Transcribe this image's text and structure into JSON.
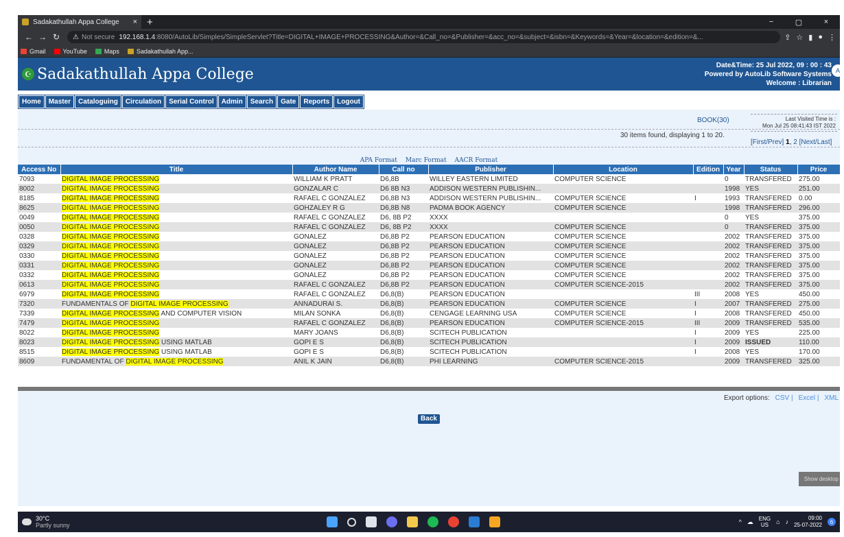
{
  "browser": {
    "tab_title": "Sadakathullah Appa College",
    "tab_close": "×",
    "new_tab": "+",
    "win_min": "−",
    "win_max": "▢",
    "win_close": "×",
    "not_secure": "Not secure",
    "url_host": "192.168.1.4",
    "url_path": ":8080/AutoLib/Simples/SimpleServlet?Title=DIGITAL+IMAGE+PROCESSING&Author=&Call_no=&Publisher=&acc_no=&subject=&isbn=&Keywords=&Year=&location=&edition=&...",
    "bookmarks": [
      {
        "label": "Gmail",
        "color": "#ea4335"
      },
      {
        "label": "YouTube",
        "color": "#ff0000"
      },
      {
        "label": "Maps",
        "color": "#34a853"
      },
      {
        "label": "Sadakathullah App...",
        "color": "#c9a227"
      }
    ]
  },
  "header": {
    "site_title": "Sadakathullah Appa College",
    "datetime": "Date&Time:  25 Jul 2022, 09 : 00 : 43",
    "powered_by": "Powered by AutoLib Software Systems",
    "welcome": "Welcome  :  Librarian"
  },
  "menu": [
    "Home",
    "Master",
    "Cataloguing",
    "Circulation",
    "Serial Control",
    "Admin",
    "Search",
    "Gate",
    "Reports",
    "Logout"
  ],
  "info": {
    "book_count": "BOOK(30)",
    "last_visited_label": "Last Visited Time is :",
    "last_visited_value": "Mon Jul 25 08:41:43 IST 2022",
    "found_text": "30 items found, displaying 1 to 20.",
    "pager_first_prev": "[First/Prev]",
    "pager_page1": "1",
    "pager_page2": "2",
    "pager_next_last": "[Next/Last]"
  },
  "formats": [
    "APA Format",
    "Marc Format",
    "AACR Format"
  ],
  "columns": [
    "Access No",
    "Title",
    "Author Name",
    "Call no",
    "Publisher",
    "Location",
    "Edition",
    "Year",
    "Status",
    "Price"
  ],
  "rows": [
    {
      "acc": "7093",
      "pre": "",
      "hl": "DIGITAL IMAGE PROCESSING",
      "post": "",
      "author": "WILLIAM K PRATT",
      "call": "D6,8B",
      "publisher": "WILLEY EASTERN LIMITED",
      "location": "COMPUTER SCIENCE",
      "edition": "",
      "year": "0",
      "status": "TRANSFERED",
      "price": "275.00"
    },
    {
      "acc": "8002",
      "pre": "",
      "hl": "DIGITAL IMAGE PROCESSING",
      "post": "",
      "author": "GONZALAR C",
      "call": "D6 8B N3",
      "publisher": "ADDISON WESTERN PUBLISHIN...",
      "location": "",
      "edition": "",
      "year": "1998",
      "status": "YES",
      "price": "251.00"
    },
    {
      "acc": "8185",
      "pre": "",
      "hl": "DIGITAL IMAGE PROCESSING",
      "post": "",
      "author": "RAFAEL C GONZALEZ",
      "call": "D6,8B N3",
      "publisher": "ADDISON WESTERN PUBLISHIN...",
      "location": "COMPUTER SCIENCE",
      "edition": "I",
      "year": "1993",
      "status": "TRANSFERED",
      "price": "0.00"
    },
    {
      "acc": "8625",
      "pre": "",
      "hl": "DIGITAL IMAGE PROCESSING",
      "post": "",
      "author": "GOHZALEY R G",
      "call": "D6,8B N8",
      "publisher": "PADMA BOOK AGENCY",
      "location": "COMPUTER SCIENCE",
      "edition": "",
      "year": "1998",
      "status": "TRANSFERED",
      "price": "296.00"
    },
    {
      "acc": "0049",
      "pre": "",
      "hl": "DIGITAL IMAGE PROCESSING",
      "post": "",
      "author": "RAFAEL C GONZALEZ",
      "call": "D6, 8B P2",
      "publisher": "XXXX",
      "location": "",
      "edition": "",
      "year": "0",
      "status": "YES",
      "price": "375.00"
    },
    {
      "acc": "0050",
      "pre": "",
      "hl": "DIGITAL IMAGE PROCESSING",
      "post": "",
      "author": "RAFAEL C GONZALEZ",
      "call": "D6, 8B P2",
      "publisher": "XXXX",
      "location": "COMPUTER SCIENCE",
      "edition": "",
      "year": "0",
      "status": "TRANSFERED",
      "price": "375.00"
    },
    {
      "acc": "0328",
      "pre": "",
      "hl": "DIGITAL IMAGE PROCESSING",
      "post": "",
      "author": "GONALEZ",
      "call": "D6,8B P2",
      "publisher": "PEARSON EDUCATION",
      "location": "COMPUTER SCIENCE",
      "edition": "",
      "year": "2002",
      "status": "TRANSFERED",
      "price": "375.00"
    },
    {
      "acc": "0329",
      "pre": "",
      "hl": "DIGITAL IMAGE PROCESSING",
      "post": "",
      "author": "GONALEZ",
      "call": "D6,8B P2",
      "publisher": "PEARSON EDUCATION",
      "location": "COMPUTER SCIENCE",
      "edition": "",
      "year": "2002",
      "status": "TRANSFERED",
      "price": "375.00"
    },
    {
      "acc": "0330",
      "pre": "",
      "hl": "DIGITAL IMAGE PROCESSING",
      "post": "",
      "author": "GONALEZ",
      "call": "D6,8B P2",
      "publisher": "PEARSON EDUCATION",
      "location": "COMPUTER SCIENCE",
      "edition": "",
      "year": "2002",
      "status": "TRANSFERED",
      "price": "375.00"
    },
    {
      "acc": "0331",
      "pre": "",
      "hl": "DIGITAL IMAGE PROCESSING",
      "post": "",
      "author": "GONALEZ",
      "call": "D6,8B P2",
      "publisher": "PEARSON EDUCATION",
      "location": "COMPUTER SCIENCE",
      "edition": "",
      "year": "2002",
      "status": "TRANSFERED",
      "price": "375.00"
    },
    {
      "acc": "0332",
      "pre": "",
      "hl": "DIGITAL IMAGE PROCESSING",
      "post": "",
      "author": "GONALEZ",
      "call": "D6,8B P2",
      "publisher": "PEARSON EDUCATION",
      "location": "COMPUTER SCIENCE",
      "edition": "",
      "year": "2002",
      "status": "TRANSFERED",
      "price": "375.00"
    },
    {
      "acc": "0613",
      "pre": "",
      "hl": "DIGITAL IMAGE PROCESSING",
      "post": "",
      "author": "RAFAEL C GONZALEZ",
      "call": "D6,8B P2",
      "publisher": "PEARSON EDUCATION",
      "location": "COMPUTER SCIENCE-2015",
      "edition": "",
      "year": "2002",
      "status": "TRANSFERED",
      "price": "375.00"
    },
    {
      "acc": "6979",
      "pre": "",
      "hl": "DIGITAL IMAGE PROCESSING",
      "post": "",
      "author": "RAFAEL C GONZALEZ",
      "call": "D6,8(B)",
      "publisher": "PEARSON EDUCATION",
      "location": "",
      "edition": "III",
      "year": "2008",
      "status": "YES",
      "price": "450.00"
    },
    {
      "acc": "7320",
      "pre": "FUNDAMENTALS OF ",
      "hl": "DIGITAL IMAGE PROCESSING",
      "post": "",
      "author": "ANNADURAI S.",
      "call": "D6,8(B)",
      "publisher": "PEARSON EDUCATION",
      "location": "COMPUTER SCIENCE",
      "edition": "I",
      "year": "2007",
      "status": "TRANSFERED",
      "price": "275.00"
    },
    {
      "acc": "7339",
      "pre": "",
      "hl": "DIGITAL IMAGE PROCESSING",
      "post": " AND COMPUTER VISION",
      "author": "MILAN SONKA",
      "call": "D6,8(B)",
      "publisher": "CENGAGE LEARNING USA",
      "location": "COMPUTER SCIENCE",
      "edition": "I",
      "year": "2008",
      "status": "TRANSFERED",
      "price": "450.00"
    },
    {
      "acc": "7479",
      "pre": "",
      "hl": "DIGITAL IMAGE PROCESSING",
      "post": "",
      "author": "RAFAEL C GONZALEZ",
      "call": "D6,8(B)",
      "publisher": "PEARSON EDUCATION",
      "location": "COMPUTER SCIENCE-2015",
      "edition": "III",
      "year": "2009",
      "status": "TRANSFERED",
      "price": "535.00"
    },
    {
      "acc": "8022",
      "pre": "",
      "hl": "DIGITAL IMAGE PROCESSING",
      "post": "",
      "author": "MARY JOANS",
      "call": "D6,8(B)",
      "publisher": "SCITECH PUBLICATION",
      "location": "",
      "edition": "I",
      "year": "2009",
      "status": "YES",
      "price": "225.00"
    },
    {
      "acc": "8023",
      "pre": "",
      "hl": "DIGITAL IMAGE PROCESSING",
      "post": " USING MATLAB",
      "author": "GOPI E S",
      "call": "D6,8(B)",
      "publisher": "SCITECH PUBLICATION",
      "location": "",
      "edition": "I",
      "year": "2009",
      "status": "ISSUED",
      "price": "110.00"
    },
    {
      "acc": "8515",
      "pre": "",
      "hl": "DIGITAL IMAGE PROCESSING",
      "post": " USING MATLAB",
      "author": "GOPI E S",
      "call": "D6,8(B)",
      "publisher": "SCITECH PUBLICATION",
      "location": "",
      "edition": "I",
      "year": "2008",
      "status": "YES",
      "price": "170.00"
    },
    {
      "acc": "8609",
      "pre": "FUNDAMENTAL OF ",
      "hl": "DIGITAL IMAGE PROCESSING",
      "post": "",
      "author": "ANIL K JAIN",
      "call": "D6,8(B)",
      "publisher": "PHI LEARNING",
      "location": "COMPUTER SCIENCE-2015",
      "edition": "",
      "year": "2009",
      "status": "TRANSFERED",
      "price": "325.00"
    }
  ],
  "export": {
    "label": "Export options:",
    "csv": "CSV |",
    "excel": "Excel |",
    "xml": "XML"
  },
  "back_label": "Back",
  "show_desktop": "Show desktop",
  "taskbar": {
    "temp": "30°C",
    "weather": "Partly sunny",
    "lang_top": "ENG",
    "lang_bottom": "US",
    "time": "09:00",
    "date": "25-07-2022",
    "notif": "6"
  },
  "colors": {
    "header_blue": "#1f5592",
    "table_header": "#2c6fb5",
    "highlight": "#ffff00",
    "issued_red": "#e02020"
  }
}
